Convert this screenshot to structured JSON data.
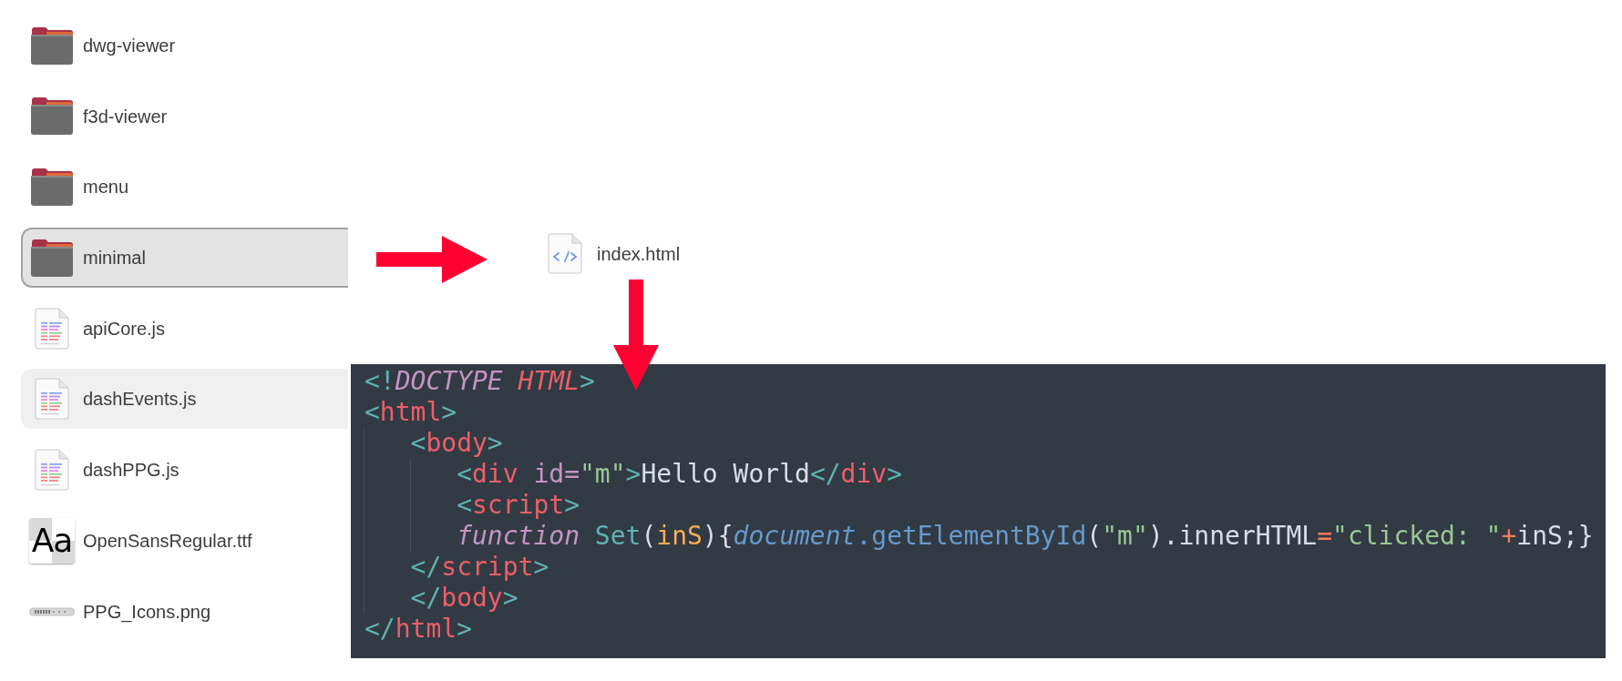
{
  "files": [
    {
      "name": "dwg-viewer",
      "kind": "folder",
      "selected": false,
      "hovered": false
    },
    {
      "name": "f3d-viewer",
      "kind": "folder",
      "selected": false,
      "hovered": false
    },
    {
      "name": "menu",
      "kind": "folder",
      "selected": false,
      "hovered": false
    },
    {
      "name": "minimal",
      "kind": "folder",
      "selected": true,
      "hovered": false
    },
    {
      "name": "apiCore.js",
      "kind": "script",
      "selected": false,
      "hovered": false
    },
    {
      "name": "dashEvents.js",
      "kind": "script",
      "selected": false,
      "hovered": true
    },
    {
      "name": "dashPPG.js",
      "kind": "script",
      "selected": false,
      "hovered": false
    },
    {
      "name": "OpenSansRegular.ttf",
      "kind": "font",
      "preview_text": "Aa",
      "selected": false,
      "hovered": false
    },
    {
      "name": "PPG_Icons.png",
      "kind": "image",
      "selected": false,
      "hovered": false
    }
  ],
  "opened_file": {
    "name": "index.html",
    "kind": "html"
  },
  "code": [
    {
      "tokens": [
        {
          "kind": "punct",
          "text": "<!"
        },
        {
          "kind": "doctype",
          "text": "DOCTYPE "
        },
        {
          "kind": "doctype_name",
          "text": "HTML"
        },
        {
          "kind": "punct",
          "text": ">"
        }
      ]
    },
    {
      "tokens": [
        {
          "kind": "punct",
          "text": "<"
        },
        {
          "kind": "tag",
          "text": "html"
        },
        {
          "kind": "punct",
          "text": ">"
        }
      ],
      "children": [
        {
          "tokens": [
            {
              "kind": "punct",
              "text": "<"
            },
            {
              "kind": "tag",
              "text": "body"
            },
            {
              "kind": "punct",
              "text": ">"
            }
          ],
          "children": [
            {
              "tokens": [
                {
                  "kind": "punct",
                  "text": "<"
                },
                {
                  "kind": "tag",
                  "text": "div"
                },
                {
                  "kind": "attr",
                  "text": " id="
                },
                {
                  "kind": "string",
                  "text": "\"m\""
                },
                {
                  "kind": "punct",
                  "text": ">"
                },
                {
                  "kind": "plain",
                  "text": "Hello World"
                },
                {
                  "kind": "punct",
                  "text": "</"
                },
                {
                  "kind": "tag",
                  "text": "div"
                },
                {
                  "kind": "punct",
                  "text": ">"
                }
              ]
            },
            {
              "tokens": [
                {
                  "kind": "punct",
                  "text": "<"
                },
                {
                  "kind": "tag",
                  "text": "script"
                },
                {
                  "kind": "punct",
                  "text": ">"
                }
              ]
            },
            {
              "tokens": [
                {
                  "kind": "keyword",
                  "text": "function "
                },
                {
                  "kind": "func",
                  "text": "Set"
                },
                {
                  "kind": "plain",
                  "text": "("
                },
                {
                  "kind": "param",
                  "text": "inS"
                },
                {
                  "kind": "plain",
                  "text": "){"
                },
                {
                  "kind": "object",
                  "text": "document"
                },
                {
                  "kind": "method",
                  "text": ".getElementById"
                },
                {
                  "kind": "plain",
                  "text": "("
                },
                {
                  "kind": "string",
                  "text": "\"m\""
                },
                {
                  "kind": "plain",
                  "text": ").innerHTML"
                },
                {
                  "kind": "operator",
                  "text": "="
                },
                {
                  "kind": "string",
                  "text": "\"clicked: \""
                },
                {
                  "kind": "operator",
                  "text": "+"
                },
                {
                  "kind": "plain",
                  "text": "inS;}"
                }
              ]
            }
          ]
        },
        {
          "tokens": [
            {
              "kind": "punct",
              "text": "</"
            },
            {
              "kind": "tag",
              "text": "script"
            },
            {
              "kind": "punct",
              "text": ">"
            }
          ]
        },
        {
          "tokens": [
            {
              "kind": "punct",
              "text": "</"
            },
            {
              "kind": "tag",
              "text": "body"
            },
            {
              "kind": "punct",
              "text": ">"
            }
          ]
        }
      ]
    },
    {
      "tokens": [
        {
          "kind": "punct",
          "text": "</"
        },
        {
          "kind": "tag",
          "text": "html"
        },
        {
          "kind": "punct",
          "text": ">"
        }
      ]
    }
  ]
}
